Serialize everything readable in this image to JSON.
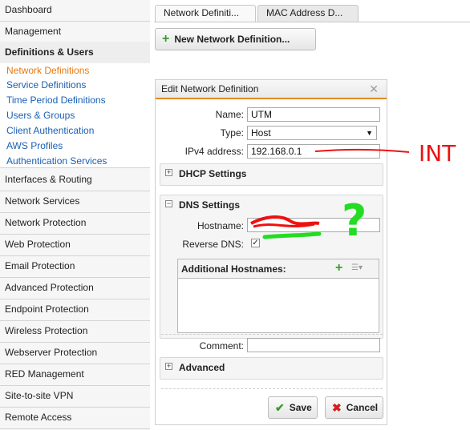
{
  "sidebar": {
    "items": [
      {
        "label": "Dashboard"
      },
      {
        "label": "Management"
      },
      {
        "label": "Definitions & Users"
      },
      {
        "label": "Interfaces & Routing"
      },
      {
        "label": "Network Services"
      },
      {
        "label": "Network Protection"
      },
      {
        "label": "Web Protection"
      },
      {
        "label": "Email Protection"
      },
      {
        "label": "Advanced Protection"
      },
      {
        "label": "Endpoint Protection"
      },
      {
        "label": "Wireless Protection"
      },
      {
        "label": "Webserver Protection"
      },
      {
        "label": "RED Management"
      },
      {
        "label": "Site-to-site VPN"
      },
      {
        "label": "Remote Access"
      }
    ],
    "subitems": [
      {
        "label": "Network Definitions"
      },
      {
        "label": "Service Definitions"
      },
      {
        "label": "Time Period Definitions"
      },
      {
        "label": "Users & Groups"
      },
      {
        "label": "Client Authentication"
      },
      {
        "label": "AWS Profiles"
      },
      {
        "label": "Authentication Services"
      }
    ]
  },
  "tabs": [
    {
      "label": "Network Definiti..."
    },
    {
      "label": "MAC Address D..."
    }
  ],
  "toolbar": {
    "new_label": "New Network Definition..."
  },
  "dialog": {
    "title": "Edit Network Definition",
    "name_label": "Name:",
    "name_value": "UTM",
    "type_label": "Type:",
    "type_value": "Host",
    "ipv4_label": "IPv4 address:",
    "ipv4_value": "192.168.0.1",
    "dhcp_title": "DHCP Settings",
    "dns_title": "DNS Settings",
    "hostname_label": "Hostname:",
    "reverse_dns_label": "Reverse DNS:",
    "reverse_dns_checked": true,
    "additional_hostnames_label": "Additional Hostnames:",
    "comment_label": "Comment:",
    "comment_value": "",
    "advanced_title": "Advanced",
    "save_label": "Save",
    "cancel_label": "Cancel"
  },
  "annotations": {
    "handwritten_text": "INT",
    "question_mark": "?"
  },
  "colors": {
    "accent_orange": "#e28a2a",
    "active_link": "#e8780e",
    "link_blue": "#1a5fb4",
    "green": "#3a9b2d",
    "cancel_red": "#d02020",
    "scribble_red": "#ee1111",
    "scribble_green": "#22dd22"
  }
}
